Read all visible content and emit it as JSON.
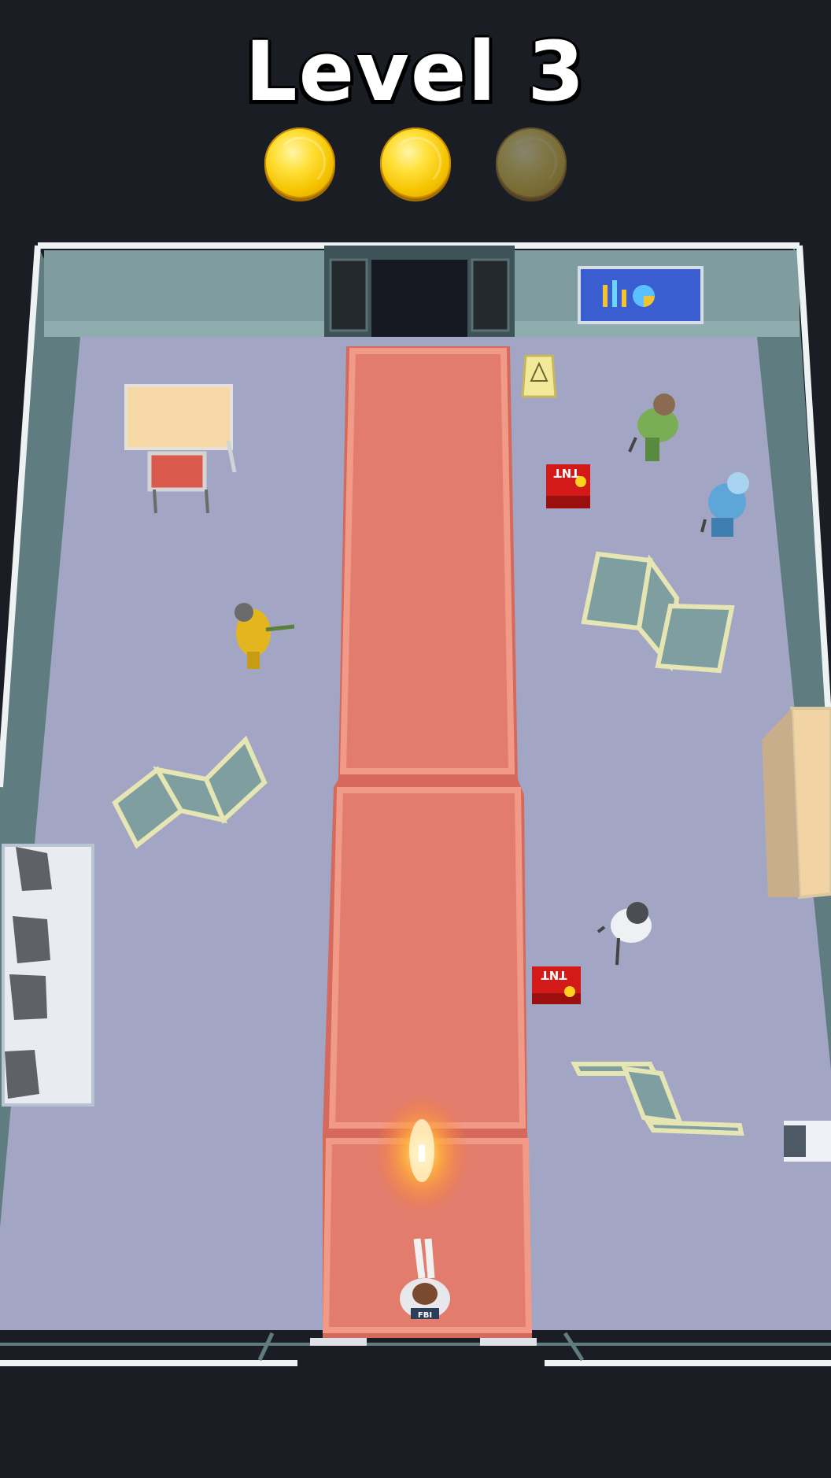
{
  "hud": {
    "level_title": "Level 3",
    "stars": [
      {
        "name": "star-1",
        "earned": true
      },
      {
        "name": "star-2",
        "earned": true
      },
      {
        "name": "star-3",
        "earned": false
      }
    ]
  },
  "scene": {
    "tnt_label": "TNT",
    "player_vest_label": "FBI",
    "colors": {
      "floor": "#a2a6c4",
      "wall": "#7f9c9e",
      "carpet": "#e27d6d",
      "carpet_border": "#f09a87",
      "tnt": "#d41919",
      "bullet_glow": "#ffb340"
    },
    "objects": [
      "desk",
      "chair",
      "wet-floor-sign",
      "wall-monitor",
      "tnt-crate",
      "tnt-crate",
      "folding-screen",
      "folding-screen",
      "folding-screen",
      "sofa",
      "bookshelf",
      "cabinet",
      "enemy-green",
      "enemy-blue",
      "enemy-yellow",
      "enemy-grey",
      "player-agent"
    ]
  }
}
